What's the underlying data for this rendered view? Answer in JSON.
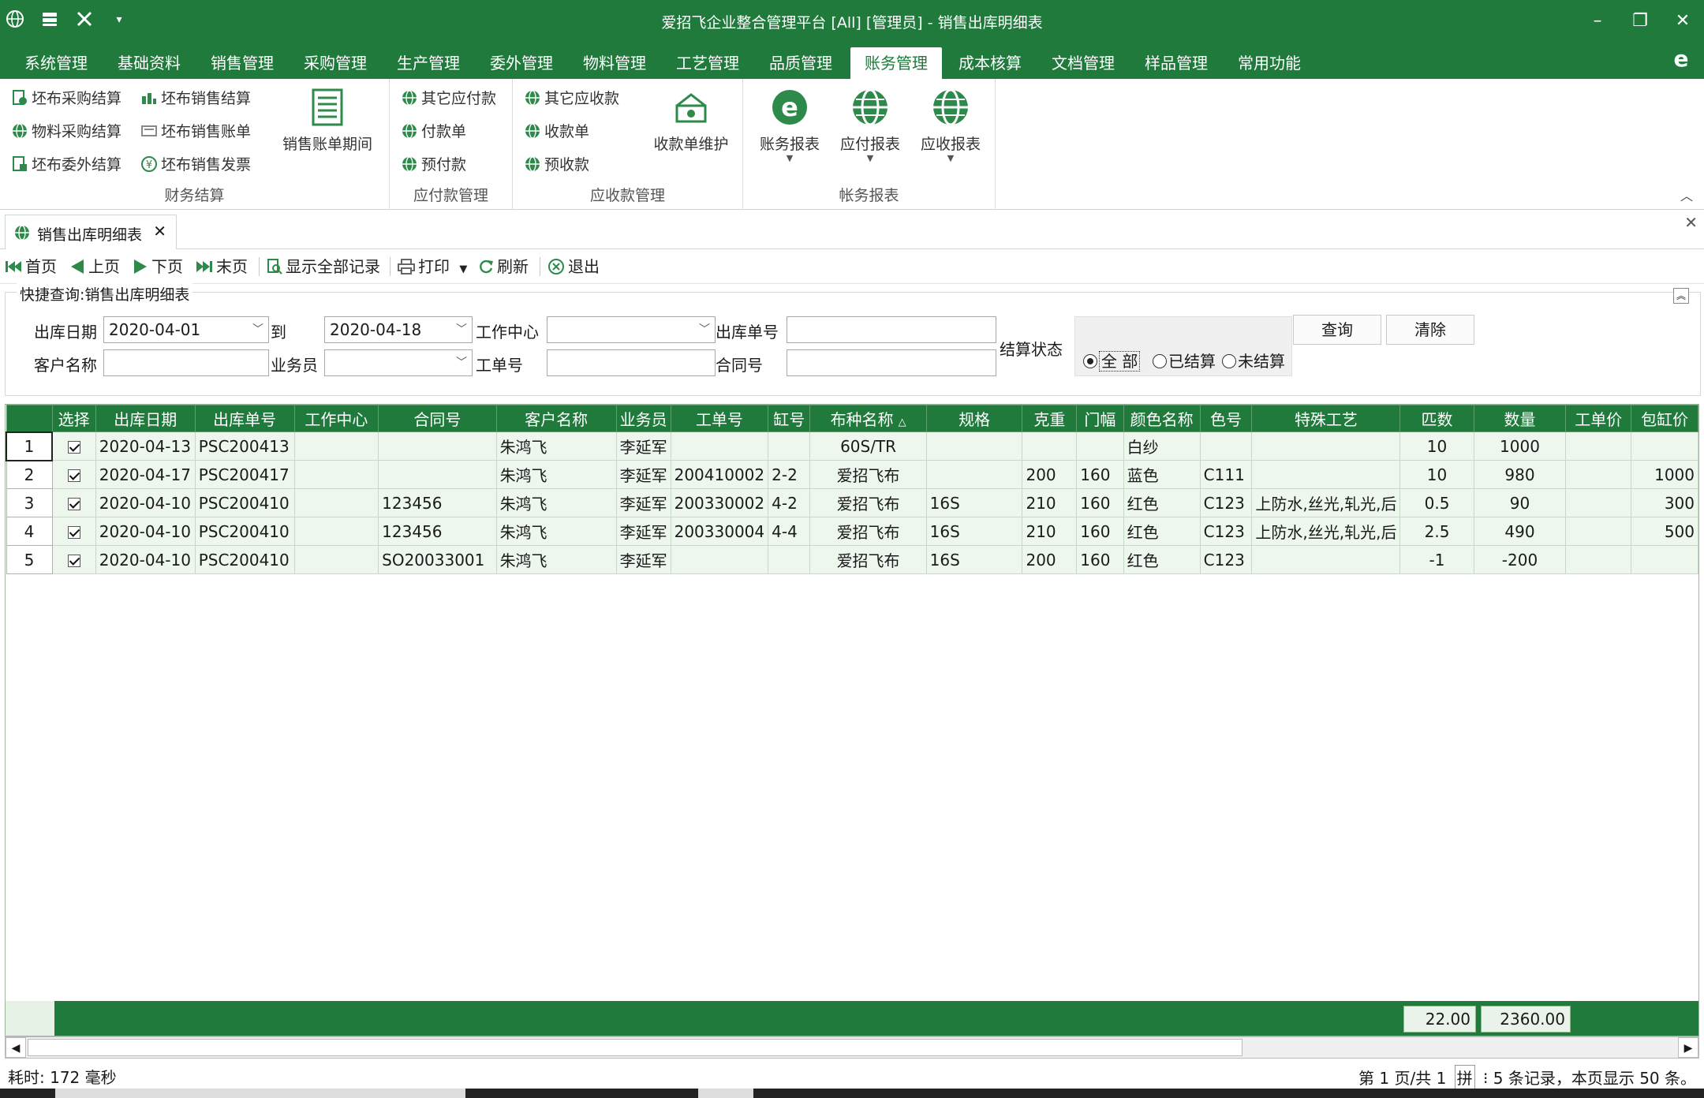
{
  "window": {
    "title": "爱招飞企业整合管理平台 [All] [管理员] - 销售出库明细表"
  },
  "menu": {
    "tabs": [
      "系统管理",
      "基础资料",
      "销售管理",
      "采购管理",
      "生产管理",
      "委外管理",
      "物料管理",
      "工艺管理",
      "品质管理",
      "账务管理",
      "成本核算",
      "文档管理",
      "样品管理",
      "常用功能"
    ],
    "active_index": 9
  },
  "ribbon": {
    "group1": {
      "title": "财务结算",
      "items": [
        "坯布采购结算",
        "坯布销售结算",
        "物料采购结算",
        "坯布销售账单",
        "坯布委外结算",
        "坯布销售发票"
      ],
      "big": "销售账单期间"
    },
    "group2": {
      "title": "应付款管理",
      "items": [
        "其它应付款",
        "付款单",
        "预付款"
      ]
    },
    "group3": {
      "title": "应收款管理",
      "items": [
        "其它应收款",
        "收款单",
        "预收款"
      ],
      "big": "收款单维护"
    },
    "group4": {
      "title": "帐务报表",
      "big": [
        "账务报表",
        "应付报表",
        "应收报表"
      ]
    }
  },
  "doc_tab": {
    "label": "销售出库明细表"
  },
  "toolbar": {
    "first": "首页",
    "prev": "上页",
    "next": "下页",
    "last": "末页",
    "show_all": "显示全部记录",
    "print": "打印",
    "refresh": "刷新",
    "exit": "退出"
  },
  "query": {
    "legend": "快捷查询:销售出库明细表",
    "date_label": "出库日期",
    "date_from": "2020-04-01",
    "to_label": "到",
    "date_to": "2020-04-18",
    "workcenter_label": "工作中心",
    "workcenter_value": "",
    "out_no_label": "出库单号",
    "out_no_value": "",
    "customer_label": "客户名称",
    "customer_value": "",
    "salesman_label": "业务员",
    "salesman_value": "",
    "job_no_label": "工单号",
    "job_no_value": "",
    "contract_label": "合同号",
    "contract_value": "",
    "settle_label": "结算状态",
    "settle_options": [
      "全  部",
      "已结算",
      "未结算"
    ],
    "settle_selected": 0,
    "search_btn": "查询",
    "clear_btn": "清除"
  },
  "grid": {
    "columns": [
      "",
      "选择",
      "出库日期",
      "出库单号",
      "工作中心",
      "合同号",
      "客户名称",
      "业务员",
      "工单号",
      "缸号",
      "布种名称",
      "规格",
      "克重",
      "门幅",
      "颜色名称",
      "色号",
      "特殊工艺",
      "匹数",
      "数量",
      "工单价",
      "包缸价"
    ],
    "rows": [
      [
        "1",
        true,
        "2020-04-13",
        "PSC200413",
        "",
        "",
        "朱鸿飞",
        "李延军",
        "",
        "",
        "60S/TR",
        "",
        "",
        "",
        "白纱",
        "",
        "",
        "10",
        "1000",
        "",
        ""
      ],
      [
        "2",
        true,
        "2020-04-17",
        "PSC200417",
        "",
        "",
        "朱鸿飞",
        "李延军",
        "200410002",
        "2-2",
        "爱招飞布",
        "",
        "200",
        "160",
        "蓝色",
        "C111",
        "",
        "10",
        "980",
        "",
        "1000"
      ],
      [
        "3",
        true,
        "2020-04-10",
        "PSC200410",
        "",
        "123456",
        "朱鸿飞",
        "李延军",
        "200330002",
        "4-2",
        "爱招飞布",
        "16S",
        "210",
        "160",
        "红色",
        "C123",
        "上防水,丝光,轧光,后",
        "0.5",
        "90",
        "",
        "300"
      ],
      [
        "4",
        true,
        "2020-04-10",
        "PSC200410",
        "",
        "123456",
        "朱鸿飞",
        "李延军",
        "200330004",
        "4-4",
        "爱招飞布",
        "16S",
        "210",
        "160",
        "红色",
        "C123",
        "上防水,丝光,轧光,后",
        "2.5",
        "490",
        "",
        "500"
      ],
      [
        "5",
        true,
        "2020-04-10",
        "PSC200410",
        "",
        "SO20033001",
        "朱鸿飞",
        "李延军",
        "",
        "",
        "爱招飞布",
        "16S",
        "200",
        "160",
        "红色",
        "C123",
        "",
        "-1",
        "-200",
        "",
        ""
      ]
    ],
    "totals": {
      "pieces": "22.00",
      "quantity": "2360.00"
    }
  },
  "status": {
    "elapsed": "耗时: 172 毫秒",
    "page_info": "第 1 页/共 1",
    "ime": "拼",
    "records": "5 条记录，本页显示 50 条。"
  },
  "colors": {
    "brand": "#1f7a3c",
    "row_bg": "#eef7ee"
  }
}
